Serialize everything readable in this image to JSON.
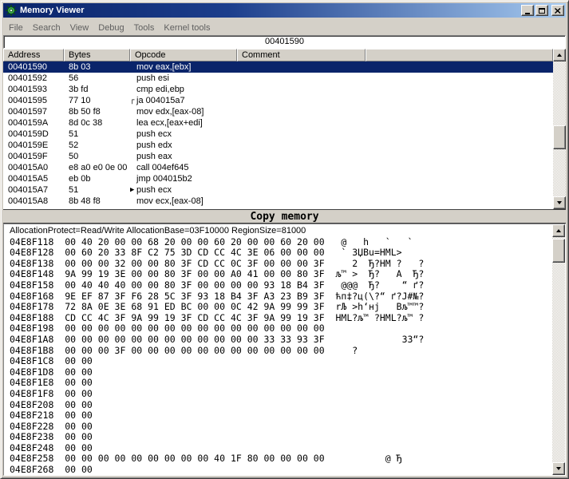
{
  "window": {
    "title": "Memory Viewer"
  },
  "menu": {
    "items": [
      "File",
      "Search",
      "View",
      "Debug",
      "Tools",
      "Kernel tools"
    ]
  },
  "address_bar": {
    "value": "00401590"
  },
  "disassembly": {
    "columns": [
      "Address",
      "Bytes",
      "Opcode",
      "Comment"
    ],
    "rows": [
      {
        "address": "00401590",
        "bytes": "8b 03",
        "marker": "",
        "opcode": "mov eax,[ebx]",
        "comment": "",
        "selected": true
      },
      {
        "address": "00401592",
        "bytes": "56",
        "marker": "",
        "opcode": "push esi",
        "comment": "",
        "selected": false
      },
      {
        "address": "00401593",
        "bytes": "3b fd",
        "marker": "",
        "opcode": "cmp edi,ebp",
        "comment": "",
        "selected": false
      },
      {
        "address": "00401595",
        "bytes": "77 10",
        "marker": "┌",
        "opcode": "ja 004015a7",
        "comment": "",
        "selected": false
      },
      {
        "address": "00401597",
        "bytes": "8b 50 f8",
        "marker": "",
        "opcode": "mov edx,[eax-08]",
        "comment": "",
        "selected": false
      },
      {
        "address": "0040159A",
        "bytes": "8d 0c 38",
        "marker": "",
        "opcode": "lea ecx,[eax+edi]",
        "comment": "",
        "selected": false
      },
      {
        "address": "0040159D",
        "bytes": "51",
        "marker": "",
        "opcode": "push ecx",
        "comment": "",
        "selected": false
      },
      {
        "address": "0040159E",
        "bytes": "52",
        "marker": "",
        "opcode": "push edx",
        "comment": "",
        "selected": false
      },
      {
        "address": "0040159F",
        "bytes": "50",
        "marker": "",
        "opcode": "push eax",
        "comment": "",
        "selected": false
      },
      {
        "address": "004015A0",
        "bytes": "e8 a0 e0 0e 00",
        "marker": "",
        "opcode": "call 004ef645",
        "comment": "",
        "selected": false
      },
      {
        "address": "004015A5",
        "bytes": "eb 0b",
        "marker": "",
        "opcode": "jmp 004015b2",
        "comment": "",
        "selected": false
      },
      {
        "address": "004015A7",
        "bytes": "51",
        "marker": "▶",
        "opcode": "push ecx",
        "comment": "",
        "selected": false
      },
      {
        "address": "004015A8",
        "bytes": "8b 48 f8",
        "marker": "",
        "opcode": "mov ecx,[eax-08]",
        "comment": "",
        "selected": false
      }
    ]
  },
  "copy_memory": {
    "label": "Copy memory"
  },
  "dump": {
    "info": "AllocationProtect=Read/Write AllocationBase=03F10000 RegionSize=81000",
    "lines": [
      {
        "address": "04E8F118",
        "bytes": "00 40 20 00 00 68 20 00 00 60 20 00 00 60 20 00",
        "ascii": " @   h   `   `  "
      },
      {
        "address": "04E8F128",
        "bytes": "00 60 20 33 8F C2 75 3D CD CC 4C 3E 06 00 00 00",
        "ascii": " ` 3ЏВu=НМL>    "
      },
      {
        "address": "04E8F138",
        "bytes": "00 00 00 32 00 00 80 3F CD CC 0C 3F 00 00 00 3F",
        "ascii": "   2  Ђ?НМ ?   ?"
      },
      {
        "address": "04E8F148",
        "bytes": "9A 99 19 3E 00 00 80 3F 00 00 A0 41 00 00 80 3F",
        "ascii": "љ™ >  Ђ?   A  Ђ?"
      },
      {
        "address": "04E8F158",
        "bytes": "00 40 40 40 00 00 80 3F 00 00 00 00 93 18 B4 3F",
        "ascii": " @@@  Ђ?    “ ґ?"
      },
      {
        "address": "04E8F168",
        "bytes": "9E EF 87 3F F6 28 5C 3F 93 18 B4 3F A3 23 B9 3F",
        "ascii": "ћп‡?ц(\\?“ ґ?Ј#№?"
      },
      {
        "address": "04E8F178",
        "bytes": "72 8A 0E 3E 68 91 ED BC 00 00 0C 42 9A 99 99 3F",
        "ascii": "rЉ >h‘нј   Bљ™™?"
      },
      {
        "address": "04E8F188",
        "bytes": "CD CC 4C 3F 9A 99 19 3F CD CC 4C 3F 9A 99 19 3F",
        "ascii": "НМL?љ™ ?НМL?љ™ ?"
      },
      {
        "address": "04E8F198",
        "bytes": "00 00 00 00 00 00 00 00 00 00 00 00 00 00 00 00",
        "ascii": ""
      },
      {
        "address": "04E8F1A8",
        "bytes": "00 00 00 00 00 00 00 00 00 00 00 00 33 33 93 3F",
        "ascii": "            33“?"
      },
      {
        "address": "04E8F1B8",
        "bytes": "00 00 00 3F 00 00 00 00 00 00 00 00 00 00 00 00",
        "ascii": "   ?            "
      },
      {
        "address": "04E8F1C8",
        "bytes": "00 00",
        "ascii": ""
      },
      {
        "address": "04E8F1D8",
        "bytes": "00 00",
        "ascii": ""
      },
      {
        "address": "04E8F1E8",
        "bytes": "00 00",
        "ascii": ""
      },
      {
        "address": "04E8F1F8",
        "bytes": "00 00",
        "ascii": ""
      },
      {
        "address": "04E8F208",
        "bytes": "00 00",
        "ascii": ""
      },
      {
        "address": "04E8F218",
        "bytes": "00 00",
        "ascii": ""
      },
      {
        "address": "04E8F228",
        "bytes": "00 00",
        "ascii": ""
      },
      {
        "address": "04E8F238",
        "bytes": "00 00",
        "ascii": ""
      },
      {
        "address": "04E8F248",
        "bytes": "00 00",
        "ascii": ""
      },
      {
        "address": "04E8F258",
        "bytes": "00 00 00 00 00 00 00 00 00 40 1F 80 00 00 00 00",
        "ascii": "         @ Ђ    "
      },
      {
        "address": "04E8F268",
        "bytes": "00 00",
        "ascii": ""
      }
    ]
  }
}
